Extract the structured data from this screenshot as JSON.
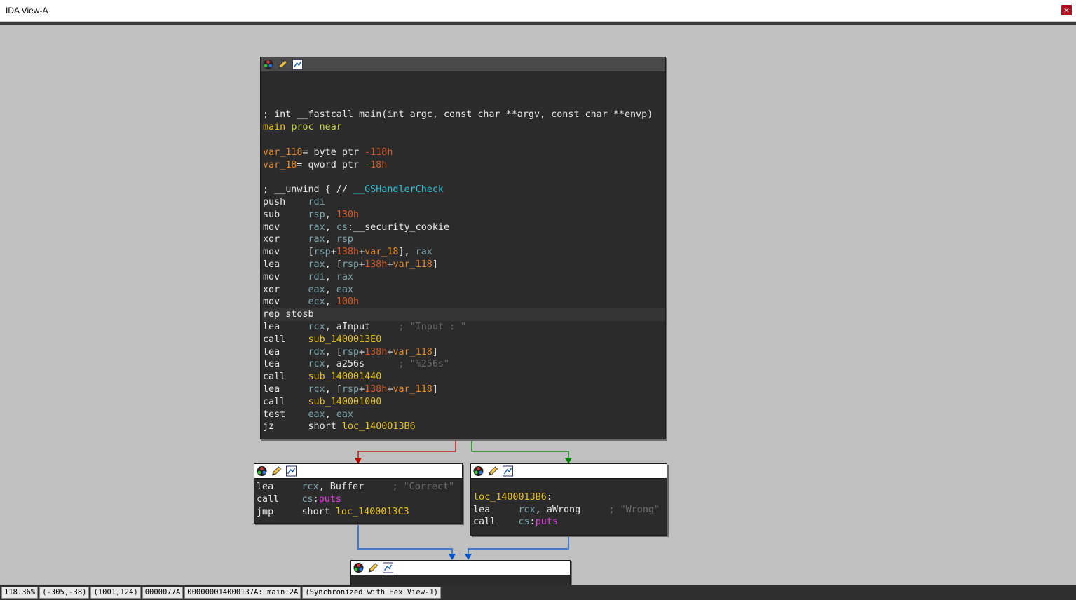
{
  "window": {
    "title": "IDA View-A",
    "close_label": "×"
  },
  "header_icons": [
    "color-palette-icon",
    "edit-pencil-icon",
    "graph-nav-icon"
  ],
  "blocks": {
    "main": {
      "lines": [
        {
          "t": "",
          "spans": []
        },
        {
          "t": "",
          "spans": []
        },
        {
          "t": "",
          "spans": []
        },
        {
          "t": "",
          "spans": [
            [
              "hdrc",
              "; int __fastcall main(int argc, const char **argv, const char **envp)"
            ]
          ]
        },
        {
          "t": "",
          "spans": [
            [
              "lbl",
              "main "
            ],
            [
              "proc",
              "proc near"
            ]
          ]
        },
        {
          "t": "",
          "spans": []
        },
        {
          "t": "",
          "spans": [
            [
              "var",
              "var_118"
            ],
            [
              "kw",
              "= byte ptr "
            ],
            [
              "num",
              "-118h"
            ]
          ]
        },
        {
          "t": "",
          "spans": [
            [
              "var",
              "var_18"
            ],
            [
              "kw",
              "= qword ptr "
            ],
            [
              "num",
              "-18h"
            ]
          ]
        },
        {
          "t": "",
          "spans": []
        },
        {
          "t": "",
          "spans": [
            [
              "kw",
              "; __unwind { // "
            ],
            [
              "fn",
              "__GSHandlerCheck"
            ]
          ]
        },
        {
          "t": "",
          "spans": [
            [
              "kw",
              "push    "
            ],
            [
              "reg",
              "rdi"
            ]
          ]
        },
        {
          "t": "",
          "spans": [
            [
              "kw",
              "sub     "
            ],
            [
              "reg",
              "rsp"
            ],
            [
              "kw",
              ", "
            ],
            [
              "num",
              "130h"
            ]
          ]
        },
        {
          "t": "",
          "spans": [
            [
              "kw",
              "mov     "
            ],
            [
              "reg",
              "rax"
            ],
            [
              "kw",
              ", "
            ],
            [
              "reg",
              "cs"
            ],
            [
              "kw",
              ":__security_cookie"
            ]
          ]
        },
        {
          "t": "",
          "spans": [
            [
              "kw",
              "xor     "
            ],
            [
              "reg",
              "rax"
            ],
            [
              "kw",
              ", "
            ],
            [
              "reg",
              "rsp"
            ]
          ]
        },
        {
          "t": "",
          "spans": [
            [
              "kw",
              "mov     ["
            ],
            [
              "reg",
              "rsp"
            ],
            [
              "kw",
              "+"
            ],
            [
              "num",
              "138h"
            ],
            [
              "kw",
              "+"
            ],
            [
              "var",
              "var_18"
            ],
            [
              "kw",
              "], "
            ],
            [
              "reg",
              "rax"
            ]
          ]
        },
        {
          "t": "",
          "spans": [
            [
              "kw",
              "lea     "
            ],
            [
              "reg",
              "rax"
            ],
            [
              "kw",
              ", ["
            ],
            [
              "reg",
              "rsp"
            ],
            [
              "kw",
              "+"
            ],
            [
              "num",
              "138h"
            ],
            [
              "kw",
              "+"
            ],
            [
              "var",
              "var_118"
            ],
            [
              "kw",
              "]"
            ]
          ]
        },
        {
          "t": "",
          "spans": [
            [
              "kw",
              "mov     "
            ],
            [
              "reg",
              "rdi"
            ],
            [
              "kw",
              ", "
            ],
            [
              "reg",
              "rax"
            ]
          ]
        },
        {
          "t": "",
          "spans": [
            [
              "kw",
              "xor     "
            ],
            [
              "reg",
              "eax"
            ],
            [
              "kw",
              ", "
            ],
            [
              "reg",
              "eax"
            ]
          ]
        },
        {
          "t": "",
          "spans": [
            [
              "kw",
              "mov     "
            ],
            [
              "reg",
              "ecx"
            ],
            [
              "kw",
              ", "
            ],
            [
              "num",
              "100h"
            ]
          ]
        },
        {
          "t": "hl",
          "spans": [
            [
              "kw",
              "rep stosb"
            ]
          ]
        },
        {
          "t": "",
          "spans": [
            [
              "kw",
              "lea     "
            ],
            [
              "reg",
              "rcx"
            ],
            [
              "kw",
              ", aInput     "
            ],
            [
              "cmt",
              "; \"Input : \""
            ]
          ]
        },
        {
          "t": "",
          "spans": [
            [
              "kw",
              "call    "
            ],
            [
              "lbl",
              "sub_1400013E0"
            ]
          ]
        },
        {
          "t": "",
          "spans": [
            [
              "kw",
              "lea     "
            ],
            [
              "reg",
              "rdx"
            ],
            [
              "kw",
              ", ["
            ],
            [
              "reg",
              "rsp"
            ],
            [
              "kw",
              "+"
            ],
            [
              "num",
              "138h"
            ],
            [
              "kw",
              "+"
            ],
            [
              "var",
              "var_118"
            ],
            [
              "kw",
              "]"
            ]
          ]
        },
        {
          "t": "",
          "spans": [
            [
              "kw",
              "lea     "
            ],
            [
              "reg",
              "rcx"
            ],
            [
              "kw",
              ", a256s      "
            ],
            [
              "cmt",
              "; \"%256s\""
            ]
          ]
        },
        {
          "t": "",
          "spans": [
            [
              "kw",
              "call    "
            ],
            [
              "lbl",
              "sub_140001440"
            ]
          ]
        },
        {
          "t": "",
          "spans": [
            [
              "kw",
              "lea     "
            ],
            [
              "reg",
              "rcx"
            ],
            [
              "kw",
              ", ["
            ],
            [
              "reg",
              "rsp"
            ],
            [
              "kw",
              "+"
            ],
            [
              "num",
              "138h"
            ],
            [
              "kw",
              "+"
            ],
            [
              "var",
              "var_118"
            ],
            [
              "kw",
              "]"
            ]
          ]
        },
        {
          "t": "",
          "spans": [
            [
              "kw",
              "call    "
            ],
            [
              "lbl",
              "sub_140001000"
            ]
          ]
        },
        {
          "t": "",
          "spans": [
            [
              "kw",
              "test    "
            ],
            [
              "reg",
              "eax"
            ],
            [
              "kw",
              ", "
            ],
            [
              "reg",
              "eax"
            ]
          ]
        },
        {
          "t": "",
          "spans": [
            [
              "kw",
              "jz      short "
            ],
            [
              "lbl",
              "loc_1400013B6"
            ]
          ]
        }
      ]
    },
    "correct": {
      "lines": [
        {
          "t": "",
          "spans": [
            [
              "kw",
              "lea     "
            ],
            [
              "reg",
              "rcx"
            ],
            [
              "kw",
              ", Buffer     "
            ],
            [
              "cmt",
              "; \"Correct\""
            ]
          ]
        },
        {
          "t": "",
          "spans": [
            [
              "kw",
              "call    "
            ],
            [
              "reg",
              "cs"
            ],
            [
              "kw",
              ":"
            ],
            [
              "imp",
              "puts"
            ]
          ]
        },
        {
          "t": "",
          "spans": [
            [
              "kw",
              "jmp     short "
            ],
            [
              "lbl",
              "loc_1400013C3"
            ]
          ]
        }
      ]
    },
    "wrong": {
      "lines": [
        {
          "t": "",
          "spans": []
        },
        {
          "t": "",
          "spans": [
            [
              "lbl",
              "loc_1400013B6"
            ],
            [
              "kw",
              ":"
            ]
          ]
        },
        {
          "t": "",
          "spans": [
            [
              "kw",
              "lea     "
            ],
            [
              "reg",
              "rcx"
            ],
            [
              "kw",
              ", aWrong     "
            ],
            [
              "cmt",
              "; \"Wrong\""
            ]
          ]
        },
        {
          "t": "",
          "spans": [
            [
              "kw",
              "call    "
            ],
            [
              "reg",
              "cs"
            ],
            [
              "kw",
              ":"
            ],
            [
              "imp",
              "puts"
            ]
          ]
        }
      ]
    }
  },
  "status": {
    "zoom": "118.36%",
    "offset": "(-305,-38)",
    "cursor": "(1001,124)",
    "file_offset": "0000077A",
    "address": "000000014000137A: main+2A",
    "sync": "(Synchronized with Hex View-1)"
  },
  "colors": {
    "false_edge": "#c00000",
    "true_edge": "#008000",
    "jump_edge": "#0050d0"
  }
}
